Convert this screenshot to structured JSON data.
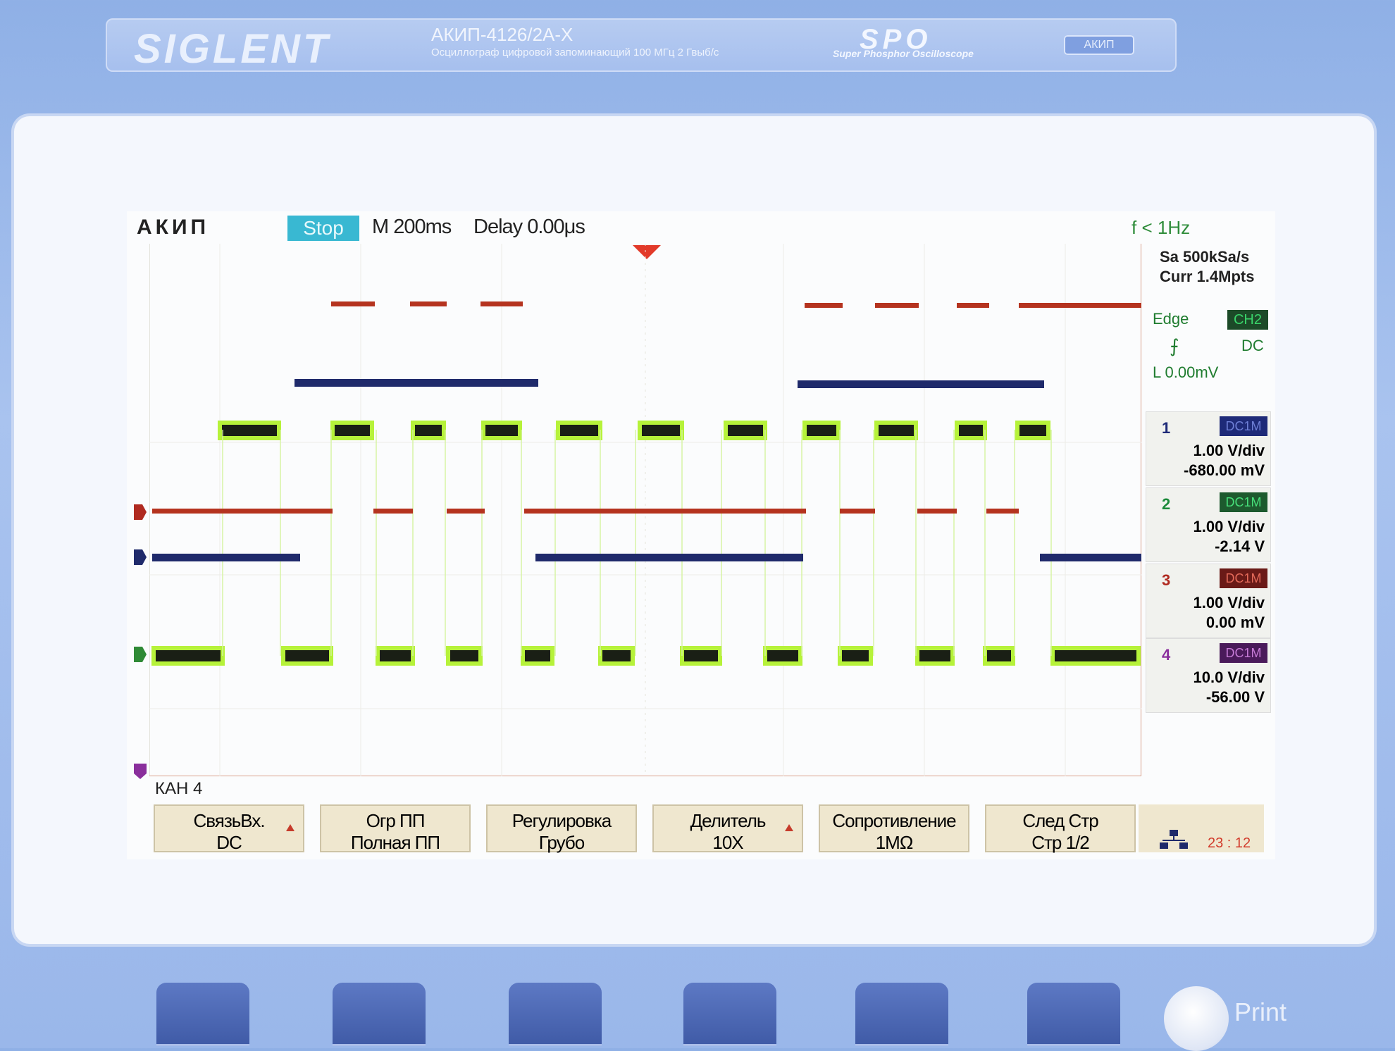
{
  "brand": {
    "logo": "SIGLENT",
    "model": "АКИП-4126/2А-Х",
    "description": "Осциллограф цифровой запоминающий  100 МГц  2 Гвыб/с",
    "spo": "SPO",
    "spo_sub": "Super Phosphor Oscilloscope",
    "badge": "АКИП"
  },
  "header": {
    "title": "АКИП",
    "run_state": "Stop",
    "timebase": "M 200ms",
    "delay": "Delay 0.00μs",
    "frequency": "f < 1Hz"
  },
  "acquisition": {
    "sample_rate": "Sa 500kSa/s",
    "memory": "Curr 1.4Mpts"
  },
  "trigger": {
    "type": "Edge",
    "source": "CH2",
    "slope_symbol": "⨍",
    "coupling": "DC",
    "level": "L  0.00mV"
  },
  "channels": [
    {
      "num": "1",
      "coupling": "DC1M",
      "vdiv": "1.00 V/div",
      "offset": "-680.00 mV",
      "color": "#1e2a78"
    },
    {
      "num": "2",
      "coupling": "DC1M",
      "vdiv": "1.00 V/div",
      "offset": "-2.14 V",
      "color": "#1c8a3a"
    },
    {
      "num": "3",
      "coupling": "DC1M",
      "vdiv": "1.00 V/div",
      "offset": "0.00 mV",
      "color": "#b02a20"
    },
    {
      "num": "4",
      "coupling": "DC1M",
      "vdiv": "10.0 V/div",
      "offset": "-56.00 V",
      "color": "#8a2f9c"
    }
  ],
  "menu": {
    "title": "КАН 4",
    "softkeys": [
      {
        "line1": "СвязьВх.",
        "line2": "DC",
        "arrow": true
      },
      {
        "line1": "Огр ПП",
        "line2": "Полная ПП",
        "arrow": false
      },
      {
        "line1": "Регулировка",
        "line2": "Грубо",
        "arrow": false
      },
      {
        "line1": "Делитель",
        "line2": "10X",
        "arrow": true
      },
      {
        "line1": "Сопротивление",
        "line2": "1MΩ",
        "arrow": false
      },
      {
        "line1": "След Стр",
        "line2": "Стр 1/2",
        "arrow": false
      }
    ]
  },
  "status": {
    "clock": "23 : 12"
  },
  "hardware": {
    "print_label": "Print"
  },
  "waveforms": {
    "trace_red_top": "#b5331f",
    "trace_navy": "#1f2a6b",
    "trace_green": "#b6f23a",
    "trace_dark": "#1a1f15"
  }
}
